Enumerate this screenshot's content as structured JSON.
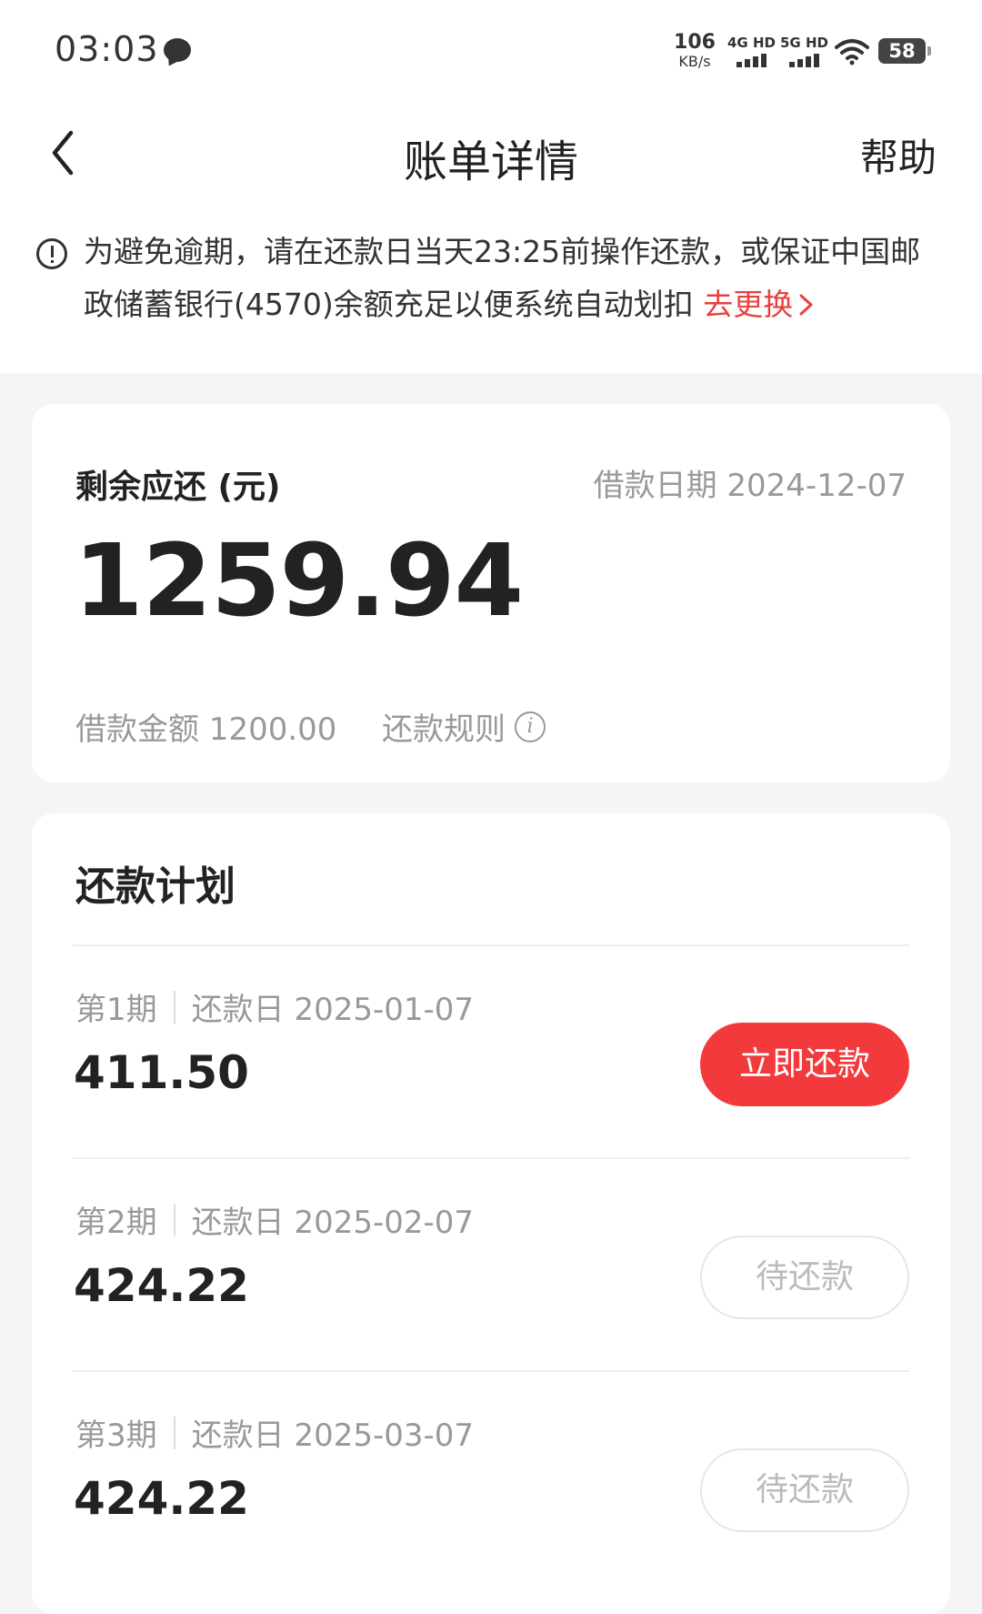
{
  "status_bar": {
    "time": "03:03",
    "net_speed_value": "106",
    "net_speed_unit": "KB/s",
    "signal_4g_label": "4G HD",
    "signal_5g_label": "5G HD",
    "battery": "58"
  },
  "nav": {
    "title": "账单详情",
    "help": "帮助"
  },
  "notice": {
    "text": "为避免逾期，请在还款日当天23:25前操作还款，或保证中国邮政储蓄银行(4570)余额充足以便系统自动划扣",
    "link": "去更换"
  },
  "summary": {
    "remaining_label": "剩余应还 (元)",
    "loan_date": "借款日期 2024-12-07",
    "remaining_amount": "1259.94",
    "loan_amount": "借款金额 1200.00",
    "rule_link": "还款规则"
  },
  "plan": {
    "title": "还款计划",
    "rows": [
      {
        "period": "第1期",
        "due": "还款日 2025-01-07",
        "amount": "411.50",
        "action": "立即还款"
      },
      {
        "period": "第2期",
        "due": "还款日 2025-02-07",
        "amount": "424.22",
        "action": "待还款"
      },
      {
        "period": "第3期",
        "due": "还款日 2025-03-07",
        "amount": "424.22",
        "action": "待还款"
      }
    ]
  },
  "colors": {
    "accent_red": "#f23a3c",
    "link_red": "#e8403f",
    "background": "#f5f5f8"
  }
}
